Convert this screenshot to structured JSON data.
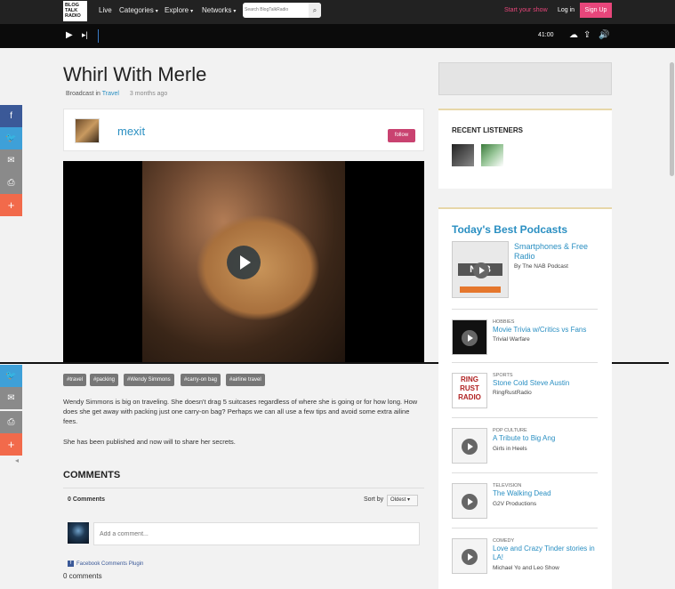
{
  "nav": {
    "logo": "BLOG TALK RADIO",
    "live": "Live",
    "categories": "Categories",
    "explore": "Explore",
    "networks": "Networks",
    "search_placeholder": "Search BlogTalkRadio",
    "start_show": "Start your show",
    "login": "Log in",
    "signup": "Sign Up"
  },
  "player": {
    "time": "41:00"
  },
  "episode": {
    "title": "Whirl With Merle",
    "broadcast_prefix": "Broadcast in",
    "category": "Travel",
    "ago": "3 months ago",
    "host": "mexit",
    "follow": "follow",
    "tags": [
      "#travel",
      "#packing",
      "#Wendy Simmons",
      "#carry-on bag",
      "#airline travel"
    ],
    "description": "Wendy Simmons is big on traveling.  She doesn't drag 5 suitcases regardless of where she is going or for how long.  How does she get away with packing just one carry-on bag?  Perhaps we can all use a few tips and avoid some extra ailine fees.",
    "description2": "She has been published and now will to share her secrets."
  },
  "comments": {
    "heading": "COMMENTS",
    "count": "0 Comments",
    "sort_label": "Sort by",
    "sort_value": "Oldest",
    "placeholder": "Add a comment...",
    "plugin": "Facebook Comments Plugin",
    "footer_count": "0 comments"
  },
  "sidebar": {
    "recent_heading": "RECENT LISTENERS",
    "today_heading": "Today's Best Podcasts",
    "featured": {
      "title": "Smartphones & Free Radio",
      "host": "By The NAB Podcast"
    },
    "podcasts": [
      {
        "category": "HOBBIES",
        "title": "Movie Trivia w/Critics vs Fans",
        "host": "Trivial Warfare"
      },
      {
        "category": "SPORTS",
        "title": "Stone Cold Steve Austin",
        "host": "RingRustRadio"
      },
      {
        "category": "POP CULTURE",
        "title": "A Tribute to Big Ang",
        "host": "Girls in Heels"
      },
      {
        "category": "TELEVISION",
        "title": "The Walking Dead",
        "host": "G2V Productions"
      },
      {
        "category": "COMEDY",
        "title": "Love and Crazy Tinder stories in LA!",
        "host": "Michael Yo and Leo Show"
      }
    ]
  },
  "colors": {
    "accent_pink": "#e8467b",
    "link_blue": "#2a8fc2",
    "facebook": "#3b5998",
    "twitter": "#3ea0d8",
    "email": "#8a8a8a",
    "print": "#8a8a8a",
    "more": "#f26a4b"
  }
}
